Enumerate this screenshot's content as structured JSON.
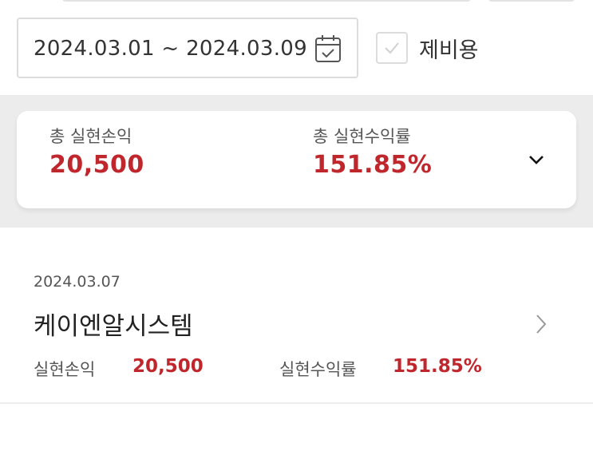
{
  "filter": {
    "date_range": "2024.03.01 ~ 2024.03.09",
    "exclude_fee_label": "제비용"
  },
  "summary": {
    "total_realized_pnl_label": "총 실현손익",
    "total_realized_pnl_value": "20,500",
    "total_realized_return_label": "총 실현수익률",
    "total_realized_return_value": "151.85%"
  },
  "trades": [
    {
      "date": "2024.03.07",
      "name": "케이엔알시스템",
      "pnl_label": "실현손익",
      "pnl_value": "20,500",
      "return_label": "실현수익률",
      "return_value": "151.85%"
    }
  ],
  "colors": {
    "accent_red": "#c0272d",
    "band_gray": "#ececec"
  },
  "icons": [
    "calendar-icon",
    "check-icon",
    "chevron-down-icon",
    "chevron-right-icon"
  ]
}
